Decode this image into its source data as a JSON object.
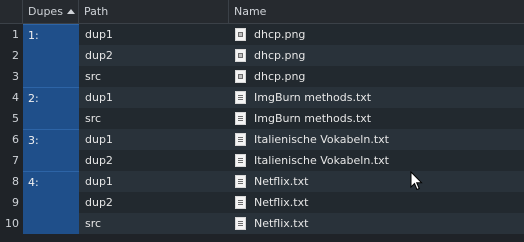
{
  "header": {
    "dupes": "Dupes",
    "path": "Path",
    "name": "Name"
  },
  "rows": [
    {
      "n": "1",
      "group": "1:",
      "path": "dup1",
      "name": "dhcp.png",
      "icon": "image-file-icon"
    },
    {
      "n": "2",
      "group": "",
      "path": "dup2",
      "name": "dhcp.png",
      "icon": "image-file-icon"
    },
    {
      "n": "3",
      "group": "",
      "path": "src",
      "name": "dhcp.png",
      "icon": "image-file-icon"
    },
    {
      "n": "4",
      "group": "2:",
      "path": "dup1",
      "name": "ImgBurn methods.txt",
      "icon": "text-file-icon"
    },
    {
      "n": "5",
      "group": "",
      "path": "src",
      "name": "ImgBurn methods.txt",
      "icon": "text-file-icon"
    },
    {
      "n": "6",
      "group": "3:",
      "path": "dup1",
      "name": "Italienische Vokabeln.txt",
      "icon": "text-file-icon"
    },
    {
      "n": "7",
      "group": "",
      "path": "dup2",
      "name": "Italienische Vokabeln.txt",
      "icon": "text-file-icon"
    },
    {
      "n": "8",
      "group": "4:",
      "path": "dup1",
      "name": "Netflix.txt",
      "icon": "text-file-icon"
    },
    {
      "n": "9",
      "group": "",
      "path": "dup2",
      "name": "Netflix.txt",
      "icon": "text-file-icon"
    },
    {
      "n": "10",
      "group": "",
      "path": "src",
      "name": "Netflix.txt",
      "icon": "text-file-icon"
    }
  ]
}
